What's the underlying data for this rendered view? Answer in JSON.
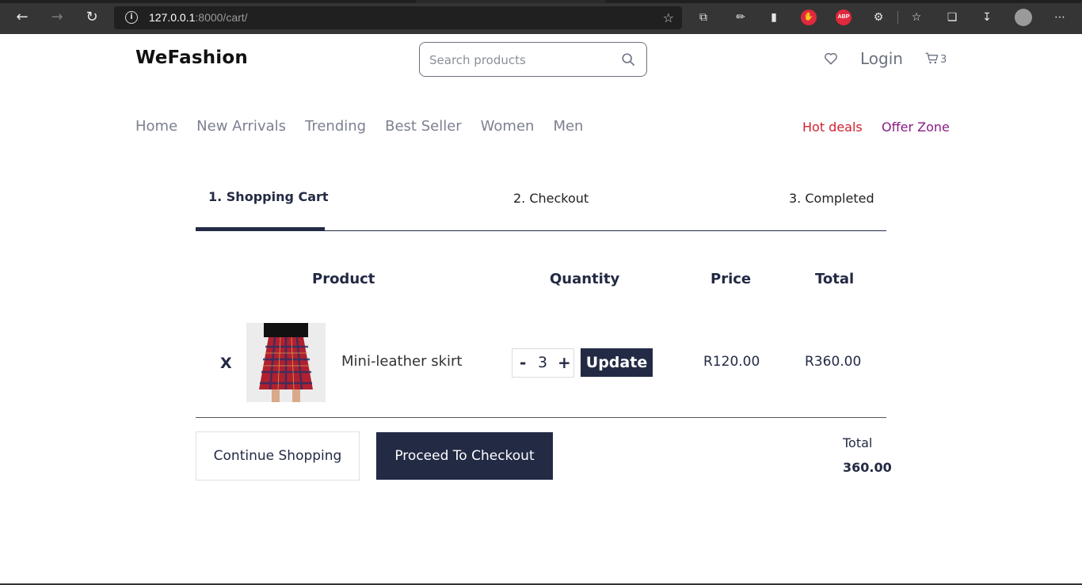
{
  "browser": {
    "url_host": "127.0.0.1",
    "url_path": ":8000/cart/",
    "ext_abp": "ABP"
  },
  "header": {
    "brand": "WeFashion",
    "search_placeholder": "Search products",
    "login": "Login",
    "cart_count": "3"
  },
  "nav": {
    "items": [
      "Home",
      "New Arrivals",
      "Trending",
      "Best Seller",
      "Women",
      "Men"
    ],
    "hot_deals": "Hot deals",
    "offer_zone": "Offer Zone"
  },
  "steps": [
    "1. Shopping Cart",
    "2. Checkout",
    "3. Completed"
  ],
  "table": {
    "headers": [
      "Product",
      "Quantity",
      "Price",
      "Total"
    ],
    "rows": [
      {
        "remove": "X",
        "name": "Mini-leather skirt",
        "quantity": "3",
        "minus": "-",
        "plus": "+",
        "update": "Update",
        "price": "R120.00",
        "total": "R360.00"
      }
    ]
  },
  "footer": {
    "continue": "Continue Shopping",
    "checkout": "Proceed To Checkout",
    "total_label": "Total",
    "total_value": "360.00"
  },
  "colors": {
    "primary": "#222a44",
    "hot": "#d0202f",
    "offer": "#8a1a86"
  }
}
